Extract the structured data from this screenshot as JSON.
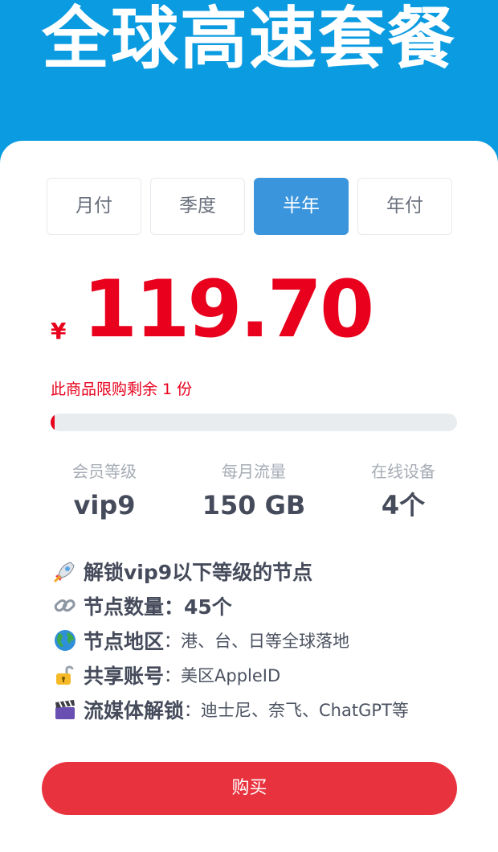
{
  "header": {
    "title": "全球高速套餐"
  },
  "tabs": [
    {
      "label": "月付",
      "active": false
    },
    {
      "label": "季度",
      "active": false
    },
    {
      "label": "半年",
      "active": true
    },
    {
      "label": "年付",
      "active": false
    }
  ],
  "price": {
    "currency": "¥",
    "amount": "119.70"
  },
  "stock": {
    "text": "此商品限购剩余 1 份",
    "progress_percent": 1
  },
  "stats": [
    {
      "label": "会员等级",
      "value": "vip9"
    },
    {
      "label": "每月流量",
      "value": "150 GB"
    },
    {
      "label": "在线设备",
      "value": "4个"
    }
  ],
  "features": [
    {
      "icon": "rocket-icon",
      "title": "解锁vip9以下等级的节点",
      "text": ""
    },
    {
      "icon": "link-icon",
      "title": "节点数量：45个",
      "text": ""
    },
    {
      "icon": "globe-icon",
      "title": "节点地区",
      "text": "港、台、日等全球落地"
    },
    {
      "icon": "unlock-icon",
      "title": "共享账号",
      "text": "美区AppleID"
    },
    {
      "icon": "clapper-icon",
      "title": "流媒体解锁",
      "text": "迪士尼、奈飞、ChatGPT等"
    }
  ],
  "buy_button": {
    "label": "购买"
  },
  "colors": {
    "banner": "#0a9be0",
    "accent": "#3a95dd",
    "price": "#e8001c",
    "buy": "#e8333f"
  }
}
